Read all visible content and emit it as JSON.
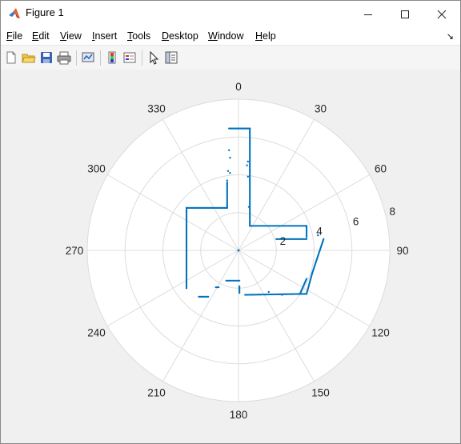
{
  "window": {
    "title": "Figure 1",
    "controls": {
      "minimize": "—",
      "maximize": "☐",
      "close": "✕"
    }
  },
  "menu": [
    "File",
    "Edit",
    "View",
    "Insert",
    "Tools",
    "Desktop",
    "Window",
    "Help"
  ],
  "menu_mnemonics": [
    "F",
    "E",
    "V",
    "I",
    "T",
    "D",
    "W",
    "H"
  ],
  "toolbar": [
    "new-figure-icon",
    "open-file-icon",
    "save-icon",
    "print-icon",
    "link-plot-icon",
    "colorbar-icon",
    "legend-icon",
    "edit-plot-pointer-icon",
    "property-inspector-icon"
  ],
  "colors": {
    "data": "#0072bd",
    "grid": "#dcdcdc",
    "axes_bg": "#ffffff"
  },
  "chart_data": {
    "type": "scatter",
    "coordinate_system": "polar",
    "theta_zero_location": "top",
    "theta_direction": "clockwise",
    "theta_ticks": [
      "0",
      "30",
      "60",
      "90",
      "120",
      "150",
      "180",
      "210",
      "240",
      "270",
      "300",
      "330"
    ],
    "r_ticks": [
      "2",
      "4",
      "6",
      "8"
    ],
    "r_tick_values": [
      2,
      4,
      6,
      8
    ],
    "rlim": [
      0,
      8
    ],
    "grid": true,
    "segments": [
      {
        "x": [
          -0.5,
          0.6
        ],
        "y": [
          6.45,
          6.45
        ]
      },
      {
        "x": [
          0.6,
          0.6
        ],
        "y": [
          1.3,
          6.45
        ]
      },
      {
        "x": [
          0.6,
          3.6
        ],
        "y": [
          1.3,
          1.3
        ]
      },
      {
        "x": [
          3.6,
          3.6
        ],
        "y": [
          1.3,
          0.7
        ]
      },
      {
        "x": [
          2.0,
          3.6
        ],
        "y": [
          0.6,
          0.6
        ]
      },
      {
        "x": [
          -2.75,
          -0.6
        ],
        "y": [
          2.25,
          2.25
        ]
      },
      {
        "x": [
          -0.6,
          -0.6
        ],
        "y": [
          2.25,
          3.6
        ]
      },
      {
        "x": [
          -2.75,
          -2.75
        ],
        "y": [
          2.25,
          -2.0
        ]
      },
      {
        "x": [
          4.5,
          3.9
        ],
        "y": [
          0.6,
          -1.2
        ]
      },
      {
        "x": [
          3.9,
          3.6
        ],
        "y": [
          -1.2,
          -2.3
        ]
      },
      {
        "x": [
          3.6,
          0.35
        ],
        "y": [
          -2.3,
          -2.35
        ]
      },
      {
        "x": [
          3.6,
          3.25
        ],
        "y": [
          -1.5,
          -2.3
        ]
      },
      {
        "x": [
          -2.1,
          -1.6
        ],
        "y": [
          -2.45,
          -2.45
        ]
      },
      {
        "x": [
          -0.65,
          0.05
        ],
        "y": [
          -1.6,
          -1.6
        ]
      },
      {
        "x": [
          -1.2,
          -1.05
        ],
        "y": [
          -1.95,
          -1.95
        ]
      },
      {
        "x": [
          0.05,
          0.05
        ],
        "y": [
          -1.9,
          -2.25
        ]
      }
    ],
    "points": [
      {
        "x": -0.5,
        "y": 5.3
      },
      {
        "x": -0.45,
        "y": 4.9
      },
      {
        "x": -0.55,
        "y": 4.2
      },
      {
        "x": -0.45,
        "y": 4.1
      },
      {
        "x": -0.6,
        "y": 3.7
      },
      {
        "x": 0.5,
        "y": 4.7
      },
      {
        "x": 0.45,
        "y": 4.5
      },
      {
        "x": 0.5,
        "y": 3.9
      },
      {
        "x": 0.55,
        "y": 2.3
      },
      {
        "x": 4.2,
        "y": 0.8
      },
      {
        "x": 2.3,
        "y": -2.35
      },
      {
        "x": 1.6,
        "y": -2.2
      }
    ]
  }
}
